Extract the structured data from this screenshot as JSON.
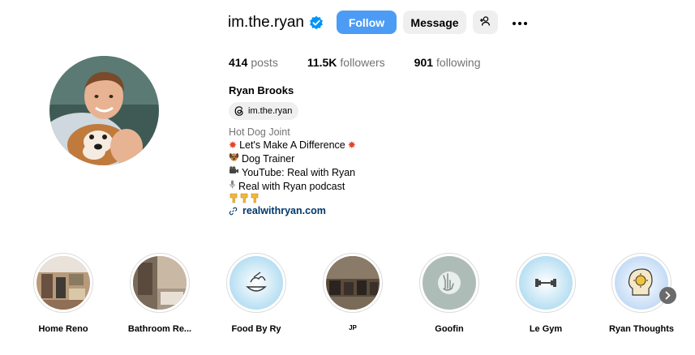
{
  "profile": {
    "username": "im.the.ryan",
    "follow_label": "Follow",
    "message_label": "Message",
    "posts_count": "414",
    "posts_label": "posts",
    "followers_count": "11.5K",
    "followers_label": "followers",
    "following_count": "901",
    "following_label": "following",
    "full_name": "Ryan Brooks",
    "threads_handle": "im.the.ryan",
    "category": "Hot Dog Joint",
    "bio_lines": [
      "Let's Make A Difference",
      "Dog Trainer",
      "YouTube: Real with Ryan",
      "Real with Ryan podcast"
    ],
    "link": "realwithryan.com"
  },
  "icons": {
    "verified": "verified-badge-icon",
    "add_person": "add-person-icon",
    "more": "more-options-icon",
    "threads": "threads-icon",
    "link": "link-icon",
    "next": "chevron-right-icon"
  },
  "colors": {
    "accent": "#4c9cf5",
    "link": "#00376b",
    "muted": "#737373",
    "button_bg": "#efefef"
  },
  "highlights": [
    {
      "label": "Home Reno"
    },
    {
      "label": "Bathroom Re..."
    },
    {
      "label": "Food By Ry"
    },
    {
      "label": "JP"
    },
    {
      "label": "Goofin"
    },
    {
      "label": "Le Gym"
    },
    {
      "label": "Ryan Thoughts"
    }
  ]
}
